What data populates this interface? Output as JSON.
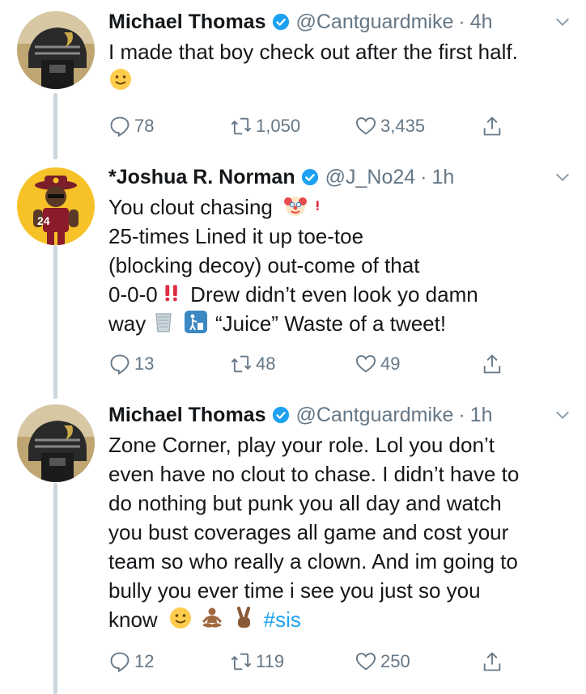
{
  "tweets": [
    {
      "name": "Michael Thomas",
      "handle": "@Cantguardmike",
      "dot": "·",
      "time": "4h",
      "line1": "I made that boy check out after the first half.",
      "replies": "78",
      "retweets": "1,050",
      "likes": "3,435"
    },
    {
      "name": "*Joshua R. Norman",
      "handle": "@J_No24",
      "dot": "·",
      "time": "1h",
      "line1": "You clout chasing",
      "line2": "25-times Lined it up toe-toe",
      "line3": "(blocking decoy) out-come of that",
      "line4a": "0-0-0",
      "line4b": "Drew didn’t even look yo damn",
      "line5a": "way",
      "line5b": "“Juice” Waste of a tweet!",
      "replies": "13",
      "retweets": "48",
      "likes": "49"
    },
    {
      "name": "Michael Thomas",
      "handle": "@Cantguardmike",
      "dot": "·",
      "time": "1h",
      "line1": "Zone Corner, play your role. Lol you don’t",
      "line2": "even have no clout to chase. I didn’t have to",
      "line3": "do nothing but punk you all day and watch",
      "line4": "you bust coverages all game and cost your",
      "line5": "team so who really a clown. And im going to",
      "line6": "bully you ever time i see you just so you",
      "line7": "know",
      "hashtag": "#sis",
      "replies": "12",
      "retweets": "119",
      "likes": "250"
    }
  ],
  "icons": {
    "verified": "verified-badge-icon",
    "caret": "chevron-down-icon",
    "reply": "reply-icon",
    "retweet": "retweet-icon",
    "like": "heart-icon",
    "share": "share-icon"
  },
  "colors": {
    "text": "#14171a",
    "secondary": "#657786",
    "accent": "#1da1f2",
    "connector": "#ccd6dd"
  },
  "avatar_badges": {
    "norman_jersey": "24"
  }
}
